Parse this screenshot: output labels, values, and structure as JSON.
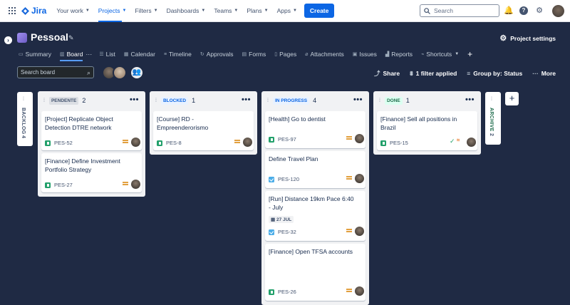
{
  "topnav": {
    "logo": "Jira",
    "items": [
      "Your work",
      "Projects",
      "Filters",
      "Dashboards",
      "Teams",
      "Plans",
      "Apps"
    ],
    "create": "Create",
    "search_placeholder": "Search"
  },
  "project": {
    "name": "Pessoal",
    "settings": "Project settings",
    "tabs": [
      "Summary",
      "Board",
      "List",
      "Calendar",
      "Timeline",
      "Approvals",
      "Forms",
      "Pages",
      "Attachments",
      "Issues",
      "Reports",
      "Shortcuts"
    ]
  },
  "board": {
    "search_placeholder": "Search board",
    "toolbar": {
      "share": "Share",
      "filter": "1 filter applied",
      "group": "Group by: Status",
      "more": "More"
    },
    "rails": {
      "backlog": {
        "label": "BACKLOG",
        "count": "4"
      },
      "archive": {
        "label": "ARCHIVE",
        "count": "2"
      }
    },
    "columns": [
      {
        "name": "PENDENTE",
        "count": "2",
        "color": "#44546f",
        "cards": [
          {
            "title": "[Project] Replicate Object Detection DTRE network",
            "key": "PES-52",
            "type": "story"
          },
          {
            "title": "[Finance] Define Investment Portfolio Strategy",
            "key": "PES-27",
            "type": "story"
          }
        ]
      },
      {
        "name": "BLOCKED",
        "count": "1",
        "color": "#0c66e4",
        "cards": [
          {
            "title": "[Course] RD - Empreenderorismo",
            "key": "PES-8",
            "type": "story"
          }
        ]
      },
      {
        "name": "IN PROGRESS",
        "count": "4",
        "color": "#0c66e4",
        "cards": [
          {
            "title": "[Health] Go to dentist",
            "key": "PES-97",
            "type": "story"
          },
          {
            "title": "Define Travel Plan",
            "key": "PES-120",
            "type": "task"
          },
          {
            "title": "[Run] Distance 19km Pace 6:40 - July",
            "key": "PES-32",
            "type": "task",
            "date": "27 JUL"
          },
          {
            "title": "[Finance] Open TFSA accounts",
            "key": "PES-26",
            "type": "story"
          }
        ]
      },
      {
        "name": "DONE",
        "count": "1",
        "color": "#216e4e",
        "cards": [
          {
            "title": "[Finance] Sell all positions in Brazil",
            "key": "PES-15",
            "type": "story"
          }
        ]
      }
    ]
  }
}
